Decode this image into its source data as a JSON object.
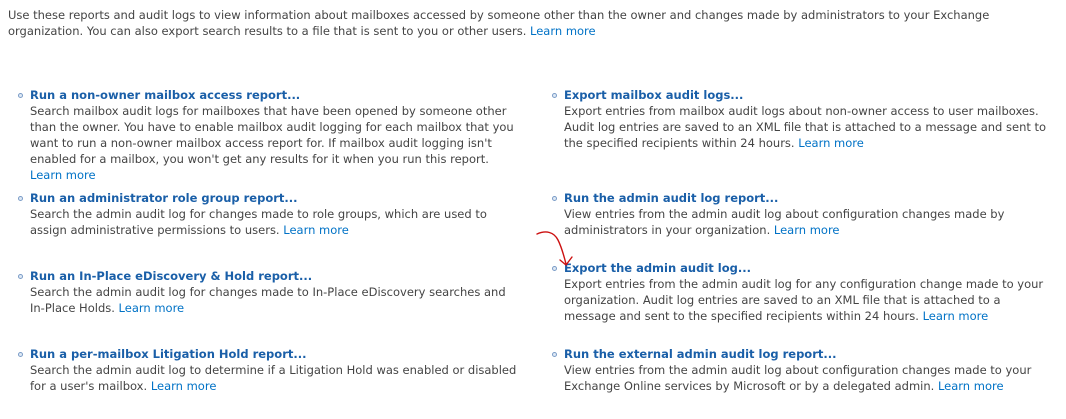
{
  "intro": {
    "text": "Use these reports and audit logs to view information about mailboxes accessed by someone other than the owner and changes made by administrators to your Exchange organization. You can also export search results to a file that is sent to you or other users.",
    "learn_more": "Learn more"
  },
  "left_items": [
    {
      "title": "Run a non-owner mailbox access report...",
      "description": "Search mailbox audit logs for mailboxes that have been opened by someone other than the owner. You have to enable mailbox audit logging for each mailbox that you want to run a non-owner mailbox access report for. If mailbox audit logging isn't enabled for a mailbox, you won't get any results for it when you run this report.",
      "learn_more": "Learn more"
    },
    {
      "title": "Run an administrator role group report...",
      "description": "Search the admin audit log for changes made to role groups, which are used to assign administrative permissions to users.",
      "learn_more": "Learn more"
    },
    {
      "title": "Run an In-Place eDiscovery & Hold report...",
      "description": "Search the admin audit log for changes made to In-Place eDiscovery searches and In-Place Holds.",
      "learn_more": "Learn more"
    },
    {
      "title": "Run a per-mailbox Litigation Hold report...",
      "description": "Search the admin audit log to determine if a Litigation Hold was enabled or disabled for a user's mailbox.",
      "learn_more": "Learn more"
    }
  ],
  "right_items": [
    {
      "title": "Export mailbox audit logs...",
      "description": "Export entries from mailbox audit logs about non-owner access to user mailboxes. Audit log entries are saved to an XML file that is attached to a message and sent to the specified recipients within 24 hours.",
      "learn_more": "Learn more"
    },
    {
      "title": "Run the admin audit log report...",
      "description": "View entries from the admin audit log about configuration changes made by administrators in your organization.",
      "learn_more": "Learn more"
    },
    {
      "title": "Export the admin audit log...",
      "description": "Export entries from the admin audit log for any configuration change made to your organization. Audit log entries are saved to an XML file that is attached to a message and sent to the specified recipients within 24 hours.",
      "learn_more": "Learn more"
    },
    {
      "title": "Run the external admin audit log report...",
      "description": "View entries from the admin audit log about configuration changes made to your Exchange Online services by Microsoft or by a delegated admin.",
      "learn_more": "Learn more"
    }
  ],
  "colors": {
    "link": "#0072c6",
    "title": "#1a5fa8",
    "annotation_arrow": "#cc1111"
  }
}
